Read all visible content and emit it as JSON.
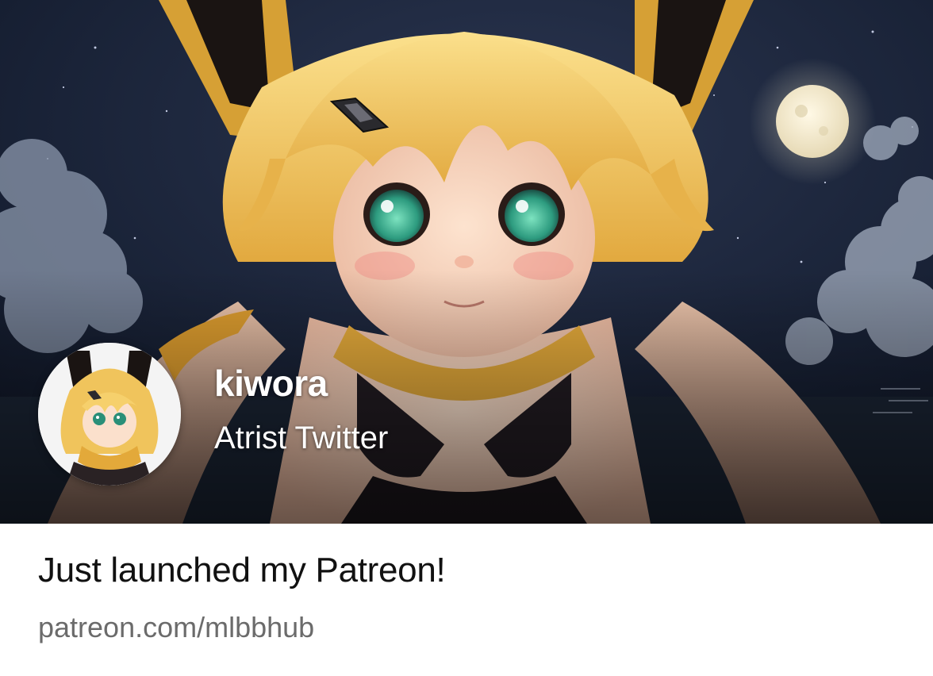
{
  "profile": {
    "name": "kiwora",
    "subtitle": "Atrist Twitter"
  },
  "post": {
    "title": "Just launched my Patreon!",
    "link": "patreon.com/mlbbhub"
  },
  "hero": {
    "image": "anime-fox-girl-moonlit-night-illustration"
  },
  "avatar": {
    "image": "anime-fox-girl-portrait"
  },
  "colors": {
    "night_sky": "#141c2c",
    "hair": "#f2c65a",
    "scarf": "#e3a93a",
    "eyes": "#3fbf9a",
    "moon": "#f3ead2",
    "title_text": "#111111",
    "link_text": "#6b6b6b"
  }
}
